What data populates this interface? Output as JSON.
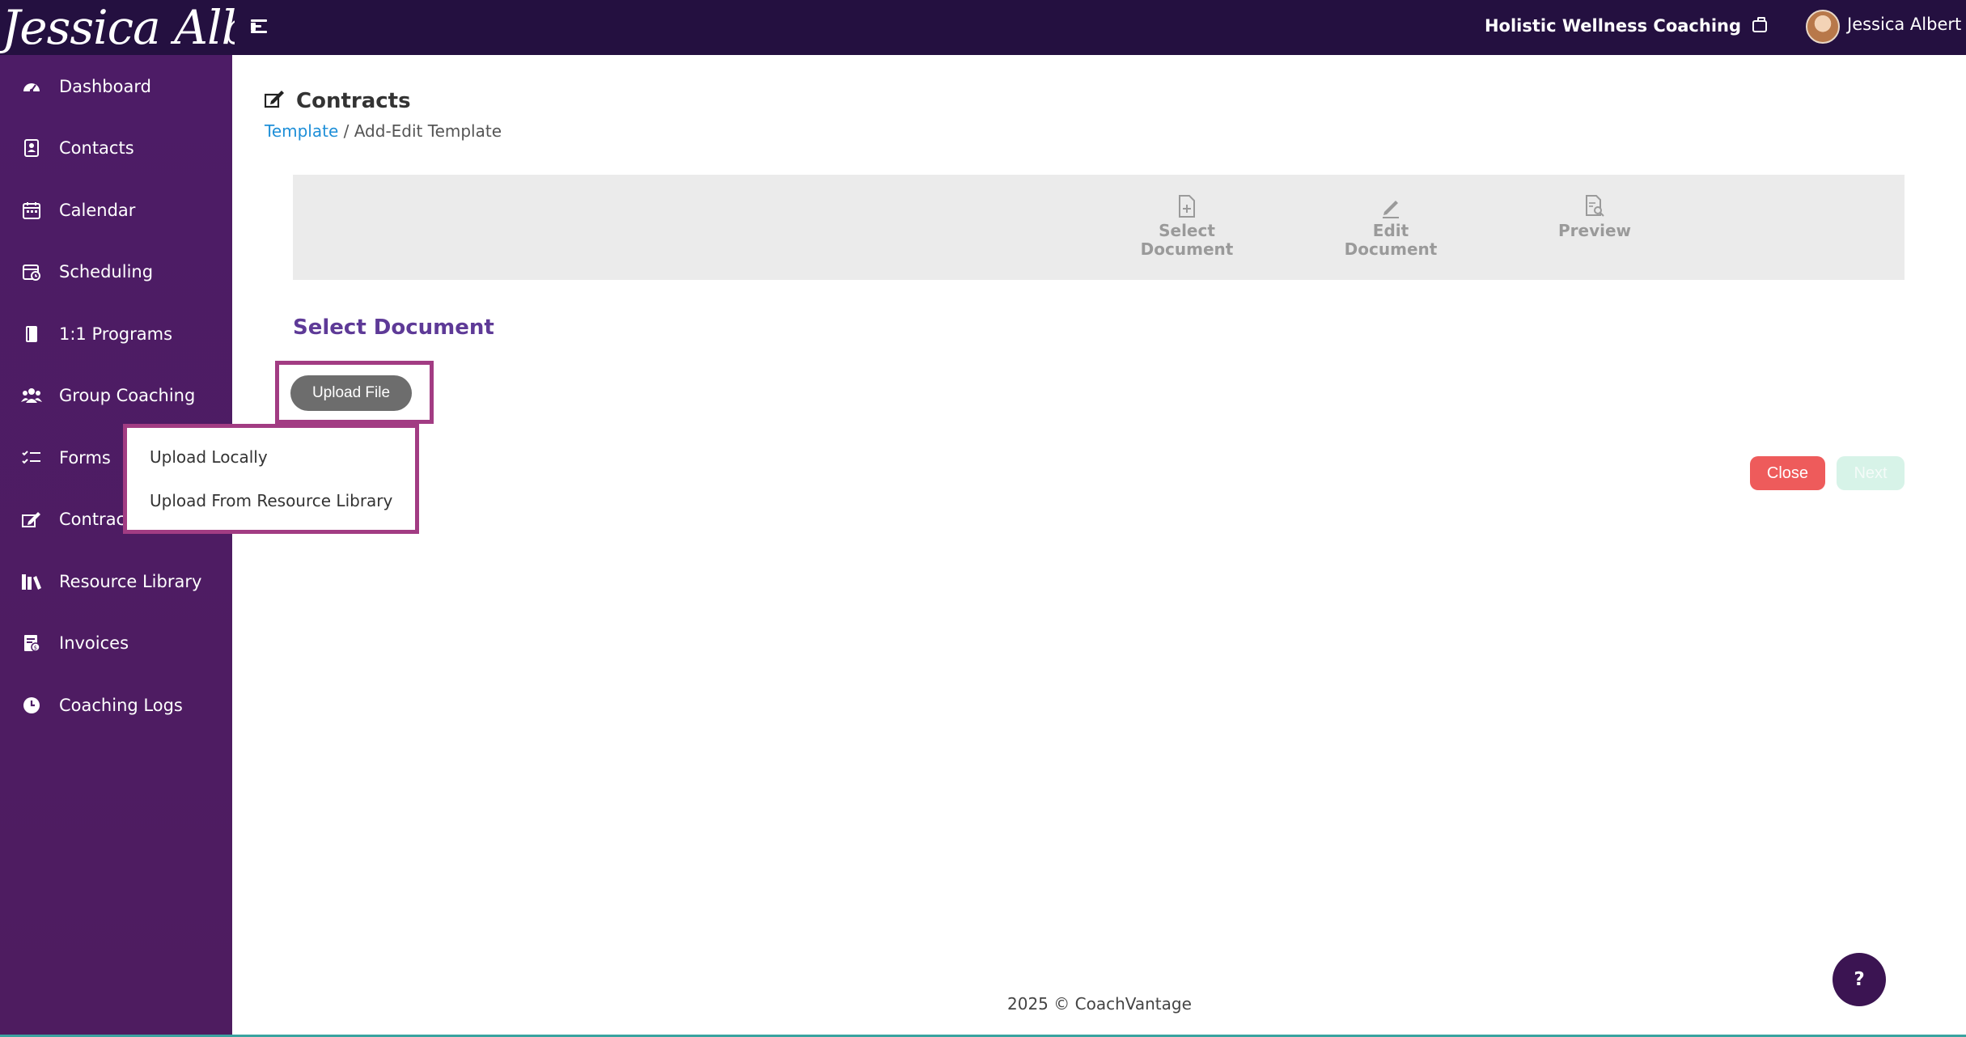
{
  "header": {
    "logo_text": "Jessica Albert",
    "org_name": "Holistic Wellness Coaching",
    "user_name": "Jessica Albert"
  },
  "sidebar": {
    "items": [
      {
        "label": "Dashboard",
        "icon": "dashboard-icon"
      },
      {
        "label": "Contacts",
        "icon": "contacts-icon"
      },
      {
        "label": "Calendar",
        "icon": "calendar-icon"
      },
      {
        "label": "Scheduling",
        "icon": "scheduling-icon"
      },
      {
        "label": "1:1 Programs",
        "icon": "book-icon"
      },
      {
        "label": "Group Coaching",
        "icon": "users-icon"
      },
      {
        "label": "Forms",
        "icon": "forms-icon"
      },
      {
        "label": "Contracts",
        "icon": "signature-icon"
      },
      {
        "label": "Resource Library",
        "icon": "library-icon"
      },
      {
        "label": "Invoices",
        "icon": "invoice-icon"
      },
      {
        "label": "Coaching Logs",
        "icon": "clock-icon"
      }
    ]
  },
  "page": {
    "title": "Contracts",
    "breadcrumb": {
      "link": "Template",
      "separator": " / ",
      "current": "Add-Edit Template"
    }
  },
  "stepper": {
    "steps": [
      {
        "line1": "Select",
        "line2": "Document"
      },
      {
        "line1": "Edit",
        "line2": "Document"
      },
      {
        "line1": "Preview",
        "line2": ""
      }
    ]
  },
  "content": {
    "section_heading": "Select Document",
    "upload_button": "Upload File",
    "menu": {
      "upload_locally": "Upload Locally",
      "upload_from_library": "Upload From Resource Library"
    },
    "close_button": "Close",
    "next_button": "Next"
  },
  "footer": {
    "text": "2025 © CoachVantage"
  },
  "help": {
    "label": "?"
  },
  "colors": {
    "topbar": "#241040",
    "sidebar": "#4d1c66",
    "highlight": "#a23c83",
    "close": "#ee5b5b",
    "next_disabled": "#d7f3e8",
    "link": "#1e8fd8",
    "heading": "#5e3a97"
  }
}
